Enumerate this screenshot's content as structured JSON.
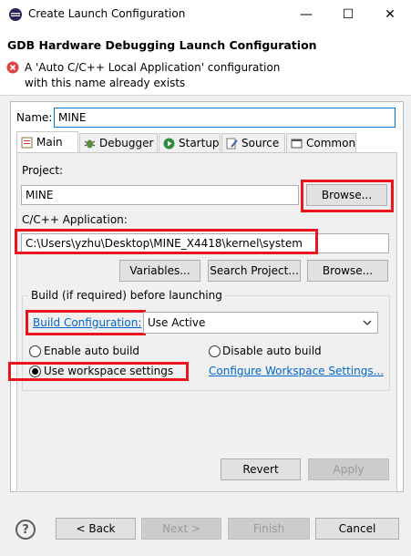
{
  "window": {
    "title": "Create Launch Configuration",
    "minimize_glyph": "—",
    "maximize_glyph": "☐",
    "close_glyph": "✕"
  },
  "header": {
    "title": "GDB Hardware Debugging Launch Configuration",
    "error_message": "A 'Auto C/C++ Local Application' configuration with this name already exists"
  },
  "name_field": {
    "label": "Name:",
    "value": "MINE"
  },
  "tabs": [
    {
      "label": "Main",
      "icon": "main-tab-icon",
      "active": true
    },
    {
      "label": "Debugger",
      "icon": "debugger-icon"
    },
    {
      "label": "Startup",
      "icon": "startup-icon"
    },
    {
      "label": "Source",
      "icon": "source-icon"
    },
    {
      "label": "Common",
      "icon": "common-icon"
    }
  ],
  "project": {
    "label": "Project:",
    "value": "MINE",
    "browse_label": "Browse..."
  },
  "application": {
    "label": "C/C++ Application:",
    "value": "C:\\Users\\yzhu\\Desktop\\MINE_X4418\\kernel\\system",
    "variables_label": "Variables...",
    "search_label": "Search Project...",
    "browse_label": "Browse..."
  },
  "build": {
    "group_label": "Build (if required) before launching",
    "config_link": "Build Configuration:",
    "config_value": "Use Active",
    "enable_auto": "Enable auto build",
    "disable_auto": "Disable auto build",
    "use_workspace": "Use workspace settings",
    "configure_link": "Configure Workspace Settings...",
    "selected": "use_workspace"
  },
  "actions": {
    "revert_label": "Revert",
    "apply_label": "Apply"
  },
  "footer": {
    "help_glyph": "?",
    "back_label": "< Back",
    "next_label": "Next >",
    "finish_label": "Finish",
    "cancel_label": "Cancel"
  },
  "colors": {
    "highlight_red": "#e8141e",
    "link_blue": "#0066cc",
    "focus_blue": "#0078d7"
  }
}
